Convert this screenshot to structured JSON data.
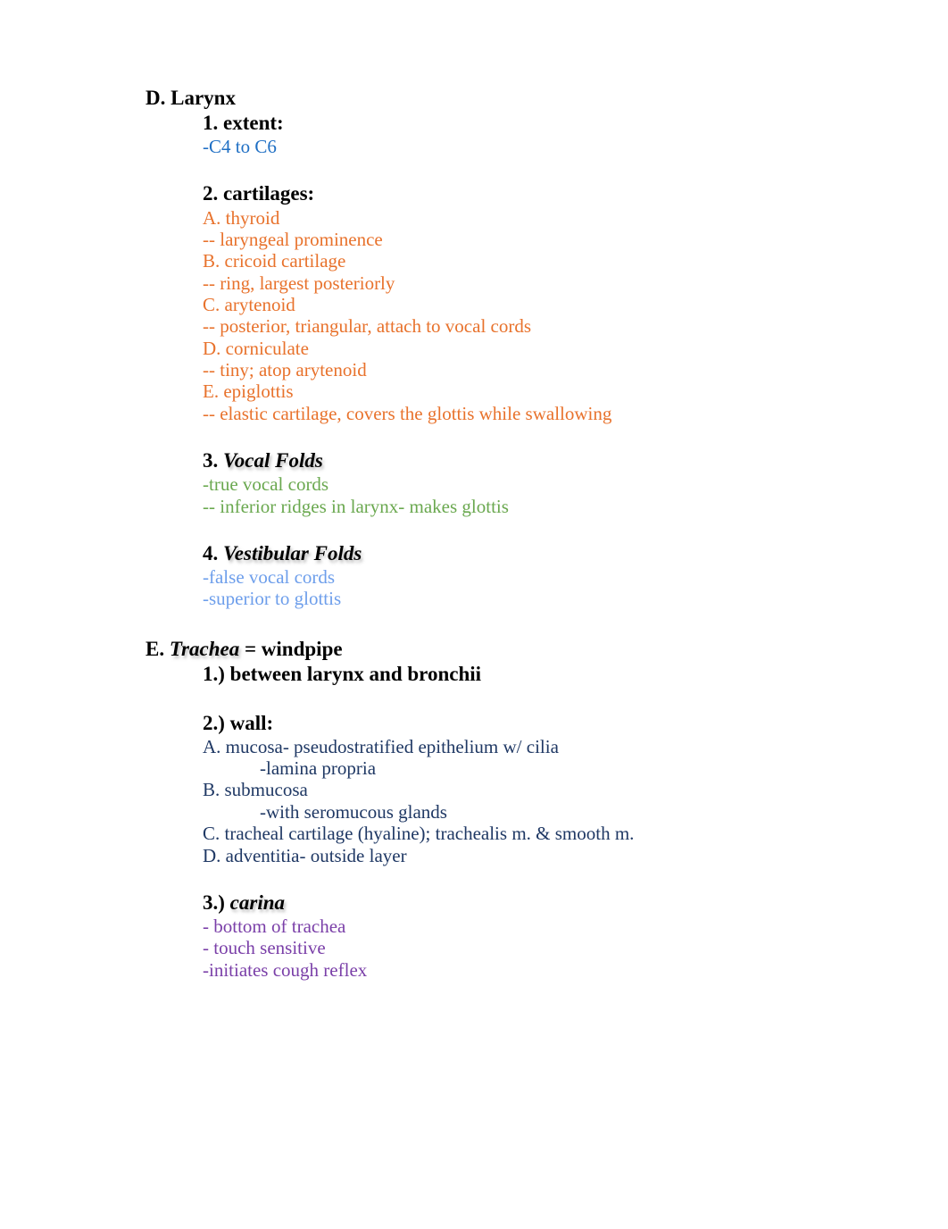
{
  "document": {
    "page_background": "#ffffff",
    "colors": {
      "heading": "#000000",
      "extent": "#1f6fc4",
      "cartilages": "#e8722c",
      "vocal_folds": "#6aa84f",
      "vestibular_folds": "#6d9eeb",
      "trachea_wall": "#1f3864",
      "carina": "#7a3fa8"
    }
  },
  "sections": {
    "larynx": {
      "heading": "D. Larynx",
      "extent": {
        "heading": "1. extent:",
        "lines": [
          "-C4 to C6"
        ]
      },
      "cartilages": {
        "heading": "2. cartilages:",
        "lines": [
          "A. thyroid",
          "-- laryngeal prominence",
          "B. cricoid cartilage",
          "-- ring, largest posteriorly",
          "C. arytenoid",
          "-- posterior, triangular, attach to vocal cords",
          "D. corniculate",
          "-- tiny; atop arytenoid",
          "E. epiglottis",
          "-- elastic cartilage, covers the glottis while swallowing"
        ]
      },
      "vocal_folds": {
        "heading_number": "3. ",
        "heading_emph": "Vocal Folds",
        "lines": [
          "-true vocal cords",
          "-- inferior ridges in larynx- makes glottis"
        ]
      },
      "vestibular_folds": {
        "heading_number": "4. ",
        "heading_emph": "Vestibular Folds",
        "lines": [
          "-false vocal cords",
          "-superior to glottis"
        ]
      }
    },
    "trachea": {
      "heading_prefix": "E. ",
      "heading_emph": "Trachea",
      "heading_suffix": " = windpipe",
      "location": {
        "heading": "1.) between larynx and bronchii"
      },
      "wall": {
        "heading": "2.) wall:",
        "items": [
          {
            "text": "A. mucosa- pseudostratified epithelium w/ cilia",
            "indent": 1
          },
          {
            "text": "-lamina propria",
            "indent": 2
          },
          {
            "text": "B. submucosa",
            "indent": 1
          },
          {
            "text": "-with seromucous glands",
            "indent": 2
          },
          {
            "text": "C. tracheal cartilage (hyaline); trachealis m. & smooth m.",
            "indent": 1
          },
          {
            "text": "D. adventitia- outside layer",
            "indent": 1
          }
        ]
      },
      "carina": {
        "heading_number": "3.) ",
        "heading_emph": "carina",
        "lines": [
          "- bottom of trachea",
          "- touch sensitive",
          "-initiates cough reflex"
        ]
      }
    }
  }
}
